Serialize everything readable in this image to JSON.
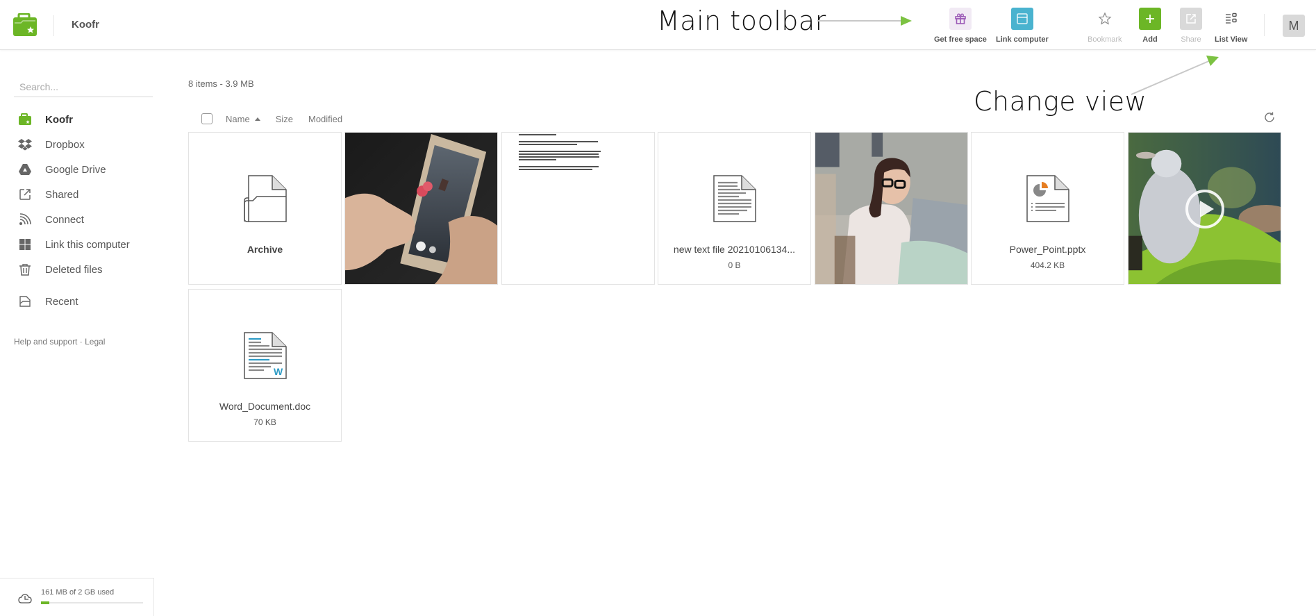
{
  "app": {
    "title": "Koofr"
  },
  "annotations": {
    "main_toolbar": "Main toolbar",
    "change_view": "Change view"
  },
  "toolbar": {
    "get_free_space": "Get free space",
    "link_computer": "Link computer",
    "bookmark": "Bookmark",
    "add": "Add",
    "share": "Share",
    "list_view": "List View",
    "avatar_initial": "M"
  },
  "colors": {
    "brand_green": "#6cb626",
    "gift_bg": "#f1eaf4",
    "gift_icon": "#9b59b6",
    "link_computer_bg": "#4ab3cf",
    "add_bg": "#6cb626",
    "share_bg": "#d6d6d6"
  },
  "sidebar": {
    "search_placeholder": "Search...",
    "items": [
      {
        "label": "Koofr",
        "icon": "koofr-folder-icon",
        "active": true
      },
      {
        "label": "Dropbox",
        "icon": "dropbox-icon"
      },
      {
        "label": "Google Drive",
        "icon": "google-drive-icon"
      },
      {
        "label": "Shared",
        "icon": "shared-icon"
      },
      {
        "label": "Connect",
        "icon": "connect-icon"
      },
      {
        "label": "Link this computer",
        "icon": "windows-icon"
      },
      {
        "label": "Deleted files",
        "icon": "trash-icon"
      },
      {
        "label": "Recent",
        "icon": "recent-icon"
      }
    ],
    "help_link": "Help and support",
    "separator": "·",
    "legal_link": "Legal",
    "quota": {
      "text": "161 MB of 2 GB used",
      "used_fraction": 0.08
    }
  },
  "main": {
    "summary": "8 items - 3.9 MB",
    "columns": {
      "name": "Name",
      "size": "Size",
      "modified": "Modified"
    },
    "sort": {
      "column": "Name",
      "direction": "ascending"
    },
    "files": [
      {
        "name": "Archive",
        "size": "",
        "type": "folder"
      },
      {
        "name": "",
        "size": "",
        "type": "image-phone"
      },
      {
        "name": "",
        "size": "",
        "type": "text-preview"
      },
      {
        "name": "new text file 20210106134...",
        "size": "0 B",
        "type": "text"
      },
      {
        "name": "",
        "size": "",
        "type": "image-woman"
      },
      {
        "name": "Power_Point.pptx",
        "size": "404.2 KB",
        "type": "pptx"
      },
      {
        "name": "",
        "size": "",
        "type": "video"
      },
      {
        "name": "Word_Document.doc",
        "size": "70 KB",
        "type": "doc"
      }
    ]
  }
}
